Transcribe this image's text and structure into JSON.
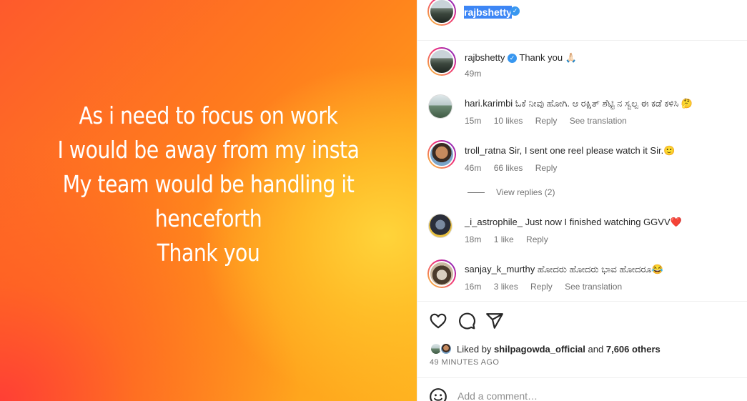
{
  "post": {
    "text_lines": [
      "As i need to focus on work",
      "I would be away from my insta",
      "My team would be handling it",
      "henceforth",
      "Thank you"
    ]
  },
  "header": {
    "username": "rajbshetty",
    "verified_icon": "verified-badge-icon"
  },
  "caption": {
    "username": "rajbshetty",
    "text": "Thank you 🙏🏻",
    "time": "49m"
  },
  "comments": [
    {
      "username": "hari.karimbi",
      "text": "ಓಕೆ ನೀವು ಹೋಗಿ. ಆ ರಕ್ಷಿತ್ ಶೆಟ್ಟಿ ನ ಸ್ವಲ್ಪ ಈ ಕಡೆ ಕಳಿಸಿ 🤔",
      "time": "15m",
      "likes": "10 likes",
      "reply": "Reply",
      "translation": "See translation"
    },
    {
      "username": "troll_ratna",
      "text": "Sir, I sent one reel please watch it Sir.🙂",
      "time": "46m",
      "likes": "66 likes",
      "reply": "Reply",
      "view_replies": "View replies (2)"
    },
    {
      "username": "_i_astrophile_",
      "text": "Just now I finished watching GGVV❤️",
      "time": "18m",
      "likes": "1 like",
      "reply": "Reply"
    },
    {
      "username": "sanjay_k_murthy",
      "text": "ಹೋದರು ಹೋದರು ಭಾವ ಹೋದರೂ😂",
      "time": "16m",
      "likes": "3 likes",
      "reply": "Reply",
      "translation": "See translation"
    }
  ],
  "likes_summary": {
    "prefix": "Liked by",
    "user": "shilpagowda_official",
    "middle": "and",
    "others": "7,606 others"
  },
  "timestamp": "49 MINUTES AGO",
  "add_comment": {
    "placeholder": "Add a comment…"
  },
  "colors": {
    "accent_blue": "#3897f0",
    "text": "#262626",
    "muted": "#737373",
    "heart_red": "#ed4956"
  }
}
